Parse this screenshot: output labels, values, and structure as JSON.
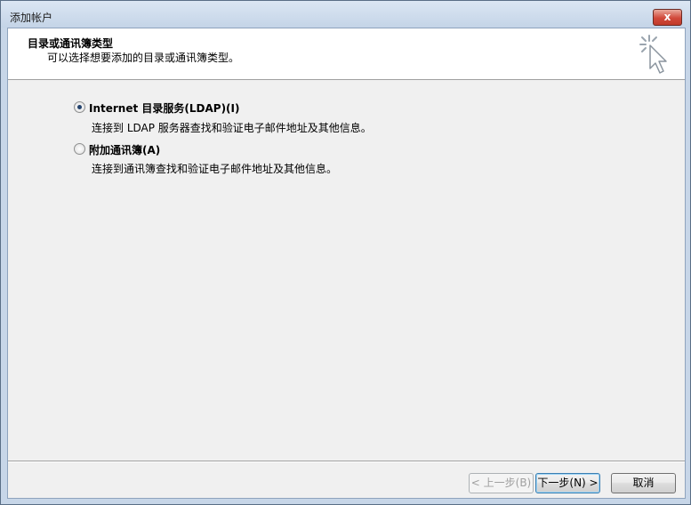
{
  "window": {
    "title": "添加帐户",
    "close_label": "x"
  },
  "header": {
    "title": "目录或通讯簿类型",
    "subtitle": "可以选择想要添加的目录或通讯簿类型。",
    "icon": "wizard-sparkle-cursor-icon"
  },
  "options": [
    {
      "label": "Internet 目录服务(LDAP)(I)",
      "description": "连接到 LDAP 服务器查找和验证电子邮件地址及其他信息。",
      "checked": true
    },
    {
      "label": "附加通讯簿(A)",
      "description": "连接到通讯簿查找和验证电子邮件地址及其他信息。",
      "checked": false
    }
  ],
  "buttons": {
    "back": "< 上一步(B)",
    "next": "下一步(N) >",
    "cancel": "取消"
  }
}
